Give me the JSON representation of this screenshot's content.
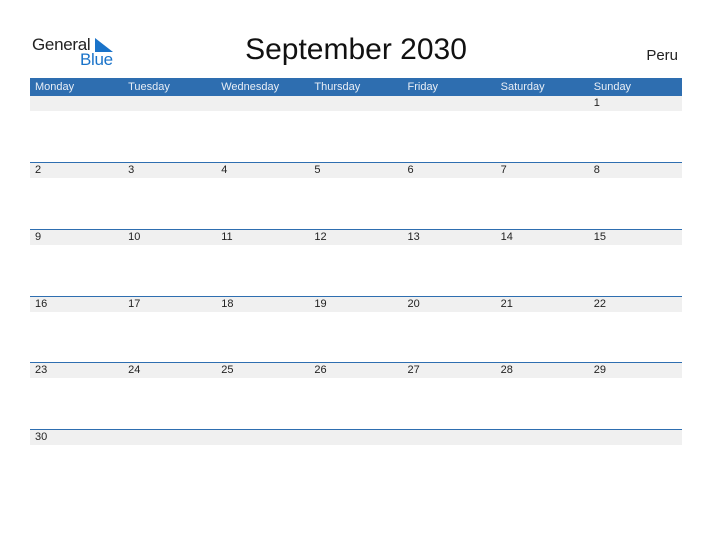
{
  "logo": {
    "word1": "General",
    "word2": "Blue"
  },
  "title": "September 2030",
  "country": "Peru",
  "colors": {
    "accent": "#2e6eb0",
    "date_strip": "#f0f0f0"
  },
  "weekdays": [
    "Monday",
    "Tuesday",
    "Wednesday",
    "Thursday",
    "Friday",
    "Saturday",
    "Sunday"
  ],
  "weeks": [
    [
      "",
      "",
      "",
      "",
      "",
      "",
      "1"
    ],
    [
      "2",
      "3",
      "4",
      "5",
      "6",
      "7",
      "8"
    ],
    [
      "9",
      "10",
      "11",
      "12",
      "13",
      "14",
      "15"
    ],
    [
      "16",
      "17",
      "18",
      "19",
      "20",
      "21",
      "22"
    ],
    [
      "23",
      "24",
      "25",
      "26",
      "27",
      "28",
      "29"
    ],
    [
      "30",
      "",
      "",
      "",
      "",
      "",
      ""
    ]
  ]
}
